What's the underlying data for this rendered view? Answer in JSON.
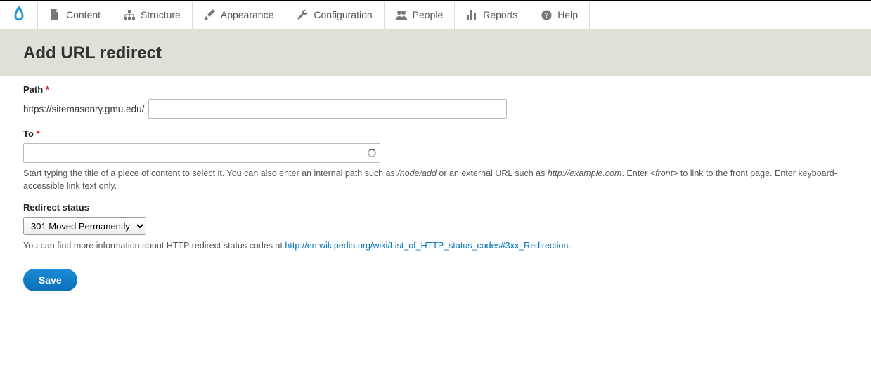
{
  "toolbar": {
    "items": [
      {
        "label": "Content"
      },
      {
        "label": "Structure"
      },
      {
        "label": "Appearance"
      },
      {
        "label": "Configuration"
      },
      {
        "label": "People"
      },
      {
        "label": "Reports"
      },
      {
        "label": "Help"
      }
    ]
  },
  "page": {
    "title": "Add URL redirect"
  },
  "form": {
    "path": {
      "label": "Path",
      "required_mark": "*",
      "prefix": "https://sitemasonry.gmu.edu/",
      "value": ""
    },
    "to": {
      "label": "To",
      "required_mark": "*",
      "value": "",
      "help_pre": "Start typing the title of a piece of content to select it. You can also enter an internal path such as ",
      "help_em1": "/node/add",
      "help_mid1": " or an external URL such as ",
      "help_em2": "http://example.com",
      "help_mid2": ". Enter ",
      "help_em3": "<front>",
      "help_post": " to link to the front page. Enter keyboard-accessible link text only."
    },
    "redirect_status": {
      "label": "Redirect status",
      "selected": "301 Moved Permanently",
      "help_pre": "You can find more information about HTTP redirect status codes at ",
      "help_link_text": "http://en.wikipedia.org/wiki/List_of_HTTP_status_codes#3xx_Redirection",
      "help_post": "."
    },
    "save_label": "Save"
  }
}
